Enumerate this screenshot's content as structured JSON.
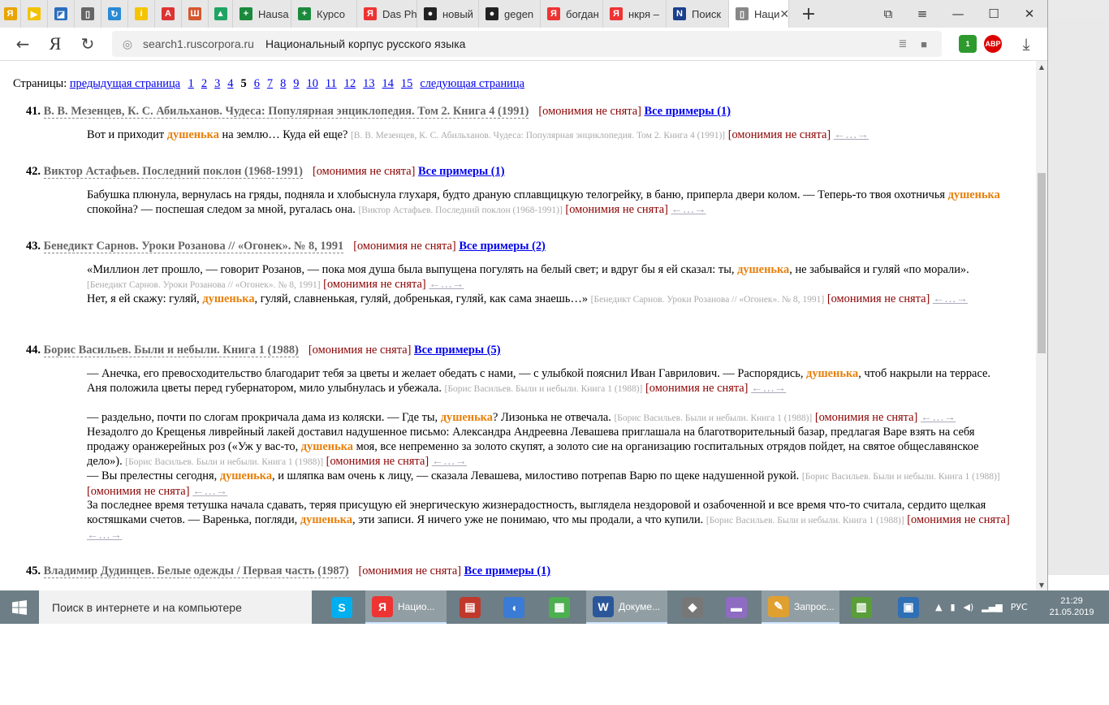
{
  "browser": {
    "tabs": [
      {
        "label": "",
        "favicon": "Я",
        "color": "#e8a500"
      },
      {
        "label": "",
        "favicon": "▶",
        "color": "#f2c200"
      },
      {
        "label": "",
        "favicon": "◪",
        "color": "#2a6ebd"
      },
      {
        "label": "",
        "favicon": "▯",
        "color": "#666"
      },
      {
        "label": "",
        "favicon": "↻",
        "color": "#2a8ad4"
      },
      {
        "label": "",
        "favicon": "i",
        "color": "#f5c400"
      },
      {
        "label": "",
        "favicon": "A",
        "color": "#d33"
      },
      {
        "label": "",
        "favicon": "Ш",
        "color": "#d6572f"
      },
      {
        "label": "",
        "favicon": "▲",
        "color": "#1fa463"
      },
      {
        "label": "Hausa",
        "favicon": "+",
        "color": "#1b8a3c"
      },
      {
        "label": "Курсо",
        "favicon": "+",
        "color": "#1b8a3c"
      },
      {
        "label": "Das Ph",
        "favicon": "Я",
        "color": "#e33"
      },
      {
        "label": "новый",
        "favicon": "●",
        "color": "#222"
      },
      {
        "label": "gegen",
        "favicon": "●",
        "color": "#222"
      },
      {
        "label": "богдан",
        "favicon": "Я",
        "color": "#e33"
      },
      {
        "label": "нкря –",
        "favicon": "Я",
        "color": "#e33"
      },
      {
        "label": "Поиск",
        "favicon": "N",
        "color": "#1c3f8c"
      },
      {
        "label": "Наци",
        "favicon": "▯",
        "color": "#888"
      }
    ],
    "new_tab": "+",
    "address": {
      "domain": "search1.ruscorpora.ru",
      "page_title": "Национальный корпус русского языка"
    },
    "ext_badge": "1",
    "abp_label": "ABP"
  },
  "pager": {
    "label": "Страницы:",
    "prev": "предыдущая страница",
    "pages": [
      "1",
      "2",
      "3",
      "4",
      "5",
      "6",
      "7",
      "8",
      "9",
      "10",
      "11",
      "12",
      "13",
      "14",
      "15"
    ],
    "current": "5",
    "next": "следующая страница"
  },
  "common": {
    "omonimia": "[омонимия не снята]",
    "ctx": "←…→"
  },
  "docs": [
    {
      "num": "41.",
      "title": "В. В. Мезенцев, К. С. Абильханов. Чудеса: Популярная энциклопедия. Том 2. Книга 4 (1991)",
      "all": "Все примеры (1)",
      "snippets": [
        {
          "a": "Вот и приходит ",
          "hl": "душенька",
          "b": " на землю… Куда ей еще?",
          "src": "[В. В. Мезенцев, К. С. Абильханов. Чудеса: Популярная энциклопедия. Том 2. Книга 4 (1991)]"
        }
      ]
    },
    {
      "num": "42.",
      "title": "Виктор Астафьев. Последний поклон (1968-1991)",
      "all": "Все примеры (1)",
      "snippets": [
        {
          "a": "Бабушка плюнула, вернулась на гряды, подняла и хлобыснула глухаря, будто драную сплавщицкую телогрейку, в баню, приперла двери колом. — Теперь-то твоя охотничья ",
          "hl": "душенька",
          "b": " спокойна? — поспешая следом за мной, ругалась она.",
          "src": "[Виктор Астафьев. Последний поклон (1968-1991)]"
        }
      ]
    },
    {
      "num": "43.",
      "title": "Бенедикт Сарнов. Уроки Розанова // «Огонек». № 8, 1991",
      "all": "Все примеры (2)",
      "snippets": [
        {
          "a": "«Миллион лет прошло, — говорит Розанов, — пока моя душа была выпущена погулять на белый свет; и вдруг бы я ей сказал: ты, ",
          "hl": "душенька",
          "b": ", не забывайся и гуляй «по морали».",
          "src": "[Бенедикт Сарнов. Уроки Розанова // «Огонек». № 8, 1991]"
        },
        {
          "a": "Нет, я ей скажу: гуляй, ",
          "hl": "душенька",
          "b": ", гуляй, славненькая, гуляй, добренькая, гуляй, как сама знаешь…»",
          "src": "[Бенедикт Сарнов. Уроки Розанова // «Огонек». № 8, 1991]"
        }
      ]
    },
    {
      "num": "44.",
      "title": "Борис Васильев. Были и небыли. Книга 1 (1988)",
      "all": "Все примеры (5)",
      "snippets": [
        {
          "a": "— Анечка, его превосходительство благодарит тебя за цветы и желает обедать с нами, — с улыбкой пояснил Иван Гаврилович. — Распорядись, ",
          "hl": "душенька",
          "b": ", чтоб накрыли на террасе. Аня положила цветы перед губернатором, мило улыбнулась и убежала.",
          "src": "[Борис Васильев. Были и небыли. Книга 1 (1988)]"
        },
        {
          "a": "— раздельно, почти по слогам прокричала дама из коляски. — Где ты, ",
          "hl": "душенька",
          "b": "? Лизонька не отвечала.",
          "src": "[Борис Васильев. Были и небыли. Книга 1 (1988)]"
        },
        {
          "a": "Незадолго до Крещенья ливрейный лакей доставил надушенное письмо: Александра Андреевна Левашева приглашала на благотворительный базар, предлагая Варе взять на себя продажу оранжерейных роз («Уж у вас-то, ",
          "hl": "душенька",
          "b": " моя, все непременно за золото скупят, а золото сие на организацию госпитальных отрядов пойдет, на святое общеславянское дело»).",
          "src": "[Борис Васильев. Были и небыли. Книга 1 (1988)]"
        },
        {
          "a": "— Вы прелестны сегодня, ",
          "hl": "душенька",
          "b": ", и шляпка вам очень к лицу, — сказала Левашева, милостиво потрепав Варю по щеке надушенной рукой.",
          "src": "[Борис Васильев. Были и небыли. Книга 1 (1988)]"
        },
        {
          "a": "За последнее время тетушка начала сдавать, теряя присущую ей энергическую жизнерадостность, выглядела нездоровой и озабоченной и все время что-то считала, сердито щелкая костяшками счетов. — Варенька, погляди, ",
          "hl": "душенька",
          "b": ", эти записи. Я ничего уже не понимаю, что мы продали, а что купили.",
          "src": "[Борис Васильев. Были и небыли. Книга 1 (1988)]"
        }
      ]
    },
    {
      "num": "45.",
      "title": "Владимир Дудинцев. Белые одежды / Первая часть (1987)",
      "all": "Все примеры (1)",
      "snippets": []
    }
  ],
  "taskbar": {
    "search_placeholder": "Поиск в интернете и на компьютере",
    "apps": [
      {
        "label": "",
        "icon": "S",
        "color": "#00aff0"
      },
      {
        "label": "Нацио...",
        "icon": "Я",
        "color": "#e33"
      },
      {
        "label": "",
        "icon": "▤",
        "color": "#c0392b"
      },
      {
        "label": "",
        "icon": "◖",
        "color": "#3a7bd5"
      },
      {
        "label": "",
        "icon": "▦",
        "color": "#4caf50"
      },
      {
        "label": "Докуме...",
        "icon": "W",
        "color": "#2b579a"
      },
      {
        "label": "",
        "icon": "◆",
        "color": "#777"
      },
      {
        "label": "",
        "icon": "▬",
        "color": "#8e6cc2"
      },
      {
        "label": "Запрос...",
        "icon": "✎",
        "color": "#e0a030"
      },
      {
        "label": "",
        "icon": "▥",
        "color": "#5a9e3a"
      },
      {
        "label": "",
        "icon": "▣",
        "color": "#2f6fb5"
      }
    ],
    "lang": "РУС",
    "time": "21:29",
    "date": "21.05.2019"
  }
}
